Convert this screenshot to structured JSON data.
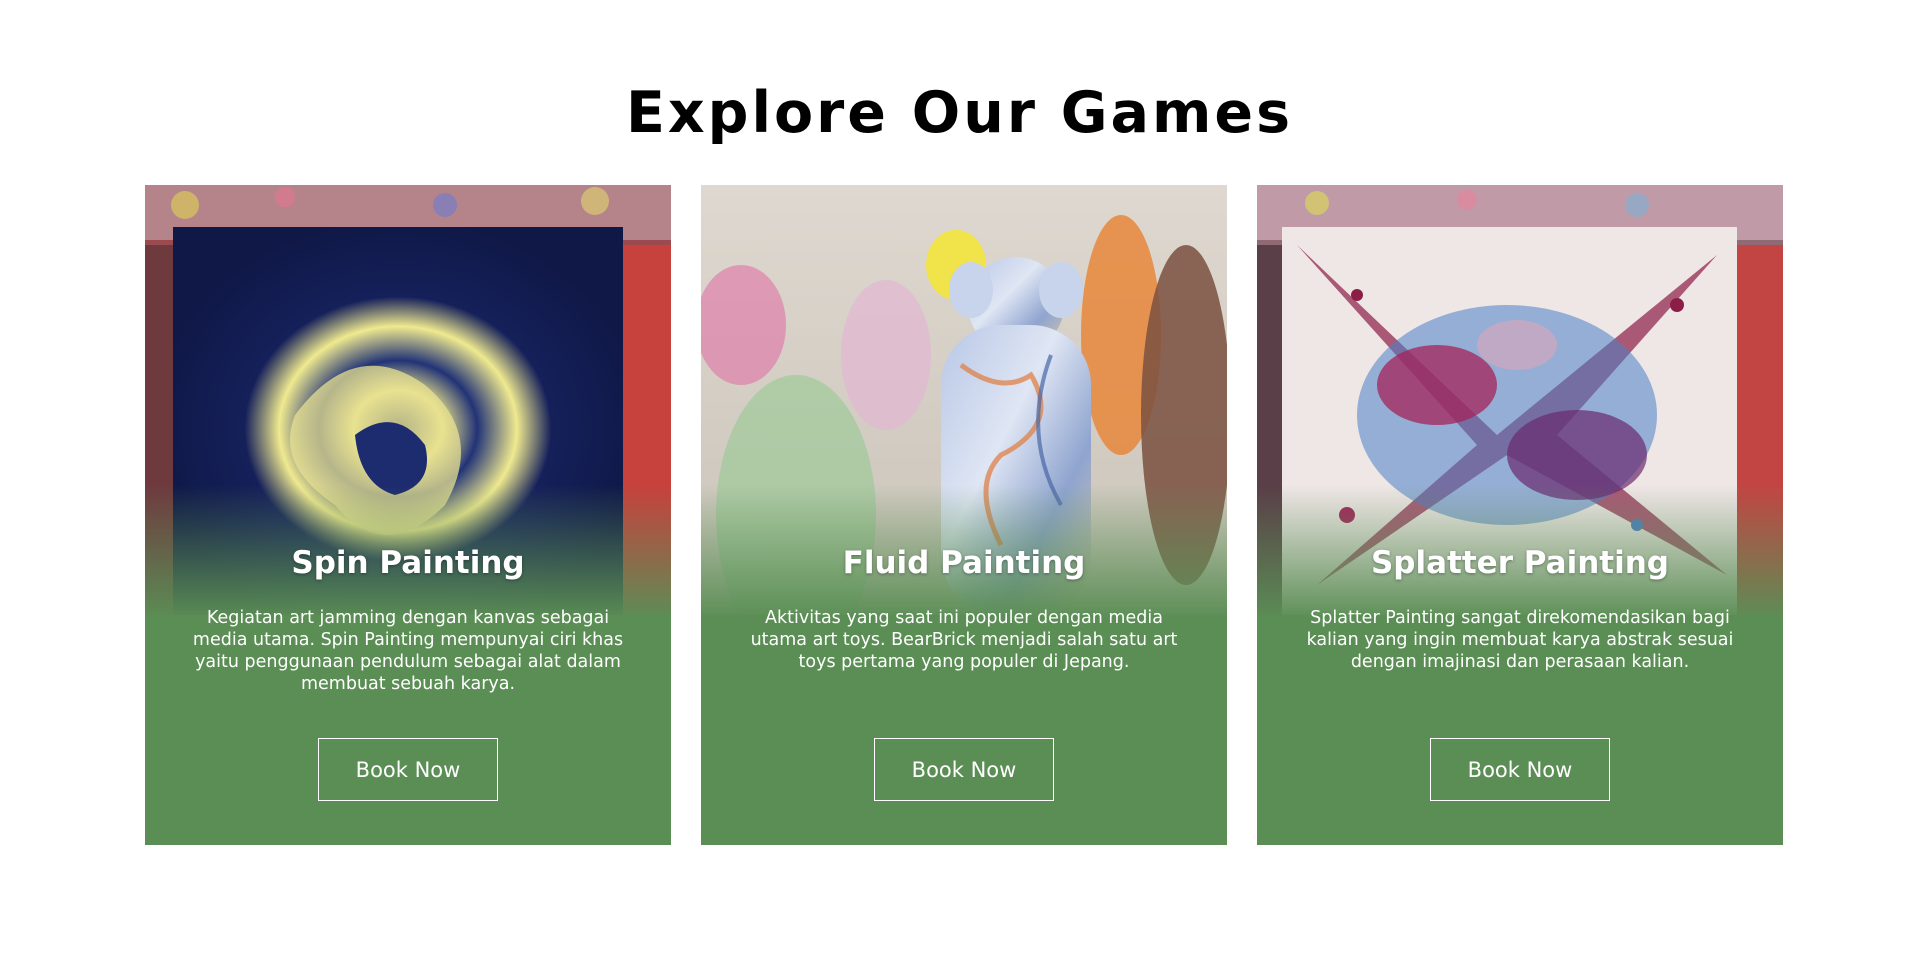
{
  "section": {
    "title": "Explore Our Games"
  },
  "cards": [
    {
      "title": "Spin Painting",
      "description": "Kegiatan art jamming dengan kanvas sebagai media utama. Spin Painting mempunyai ciri khas yaitu penggunaan pendulum sebagai alat dalam membuat sebuah karya.",
      "button_label": "Book Now"
    },
    {
      "title": "Fluid Painting",
      "description": "Aktivitas yang saat ini populer dengan media utama art toys. BearBrick menjadi salah satu art toys pertama yang populer di Jepang.",
      "button_label": "Book Now"
    },
    {
      "title": "Splatter Painting",
      "description": "Splatter Painting sangat direkomendasikan bagi kalian yang ingin membuat karya abstrak sesuai dengan imajinasi dan perasaan kalian.",
      "button_label": "Book Now"
    }
  ],
  "colors": {
    "card_background": "#5b8e55",
    "title_text": "#000000",
    "card_text": "#ffffff"
  }
}
